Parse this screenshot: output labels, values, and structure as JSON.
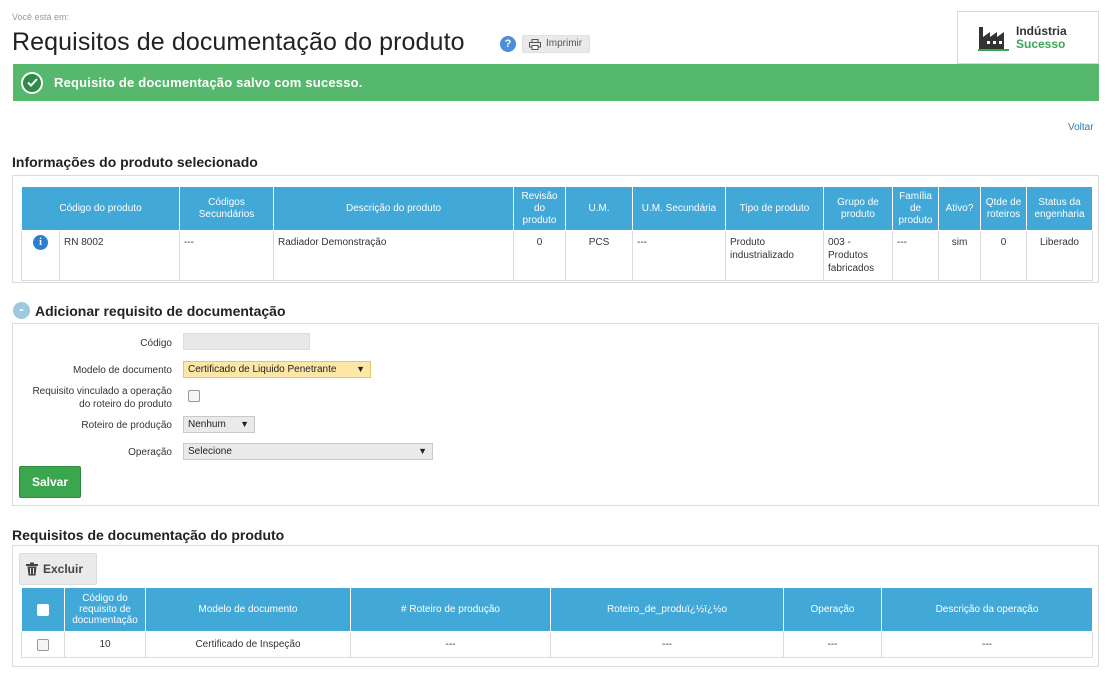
{
  "header": {
    "breadcrumb_label": "Você está em:",
    "title": "Requisitos de documentação do produto",
    "help_icon": "?",
    "print_label": "Imprimir",
    "logo_line1": "Indústria",
    "logo_line2": "Sucesso"
  },
  "alert": {
    "message": "Requisito de documentação salvo com sucesso."
  },
  "back_link": "Voltar",
  "product_info": {
    "section_title": "Informações do produto selecionado",
    "columns": [
      "Código do produto",
      "Códigos Secundários",
      "Descrição do produto",
      "Revisão do produto",
      "U.M.",
      "U.M. Secundária",
      "Tipo de produto",
      "Grupo de produto",
      "Família de produto",
      "Ativo?",
      "Qtde de roteiros",
      "Status da engenharia"
    ],
    "row": {
      "codigo": "RN 8002",
      "codigos_secundarios": "---",
      "descricao": "Radiador Demonstração",
      "revisao": "0",
      "um": "PCS",
      "um_secundaria": "---",
      "tipo": "Produto industrializado",
      "grupo": "003 - Produtos fabricados",
      "familia": "---",
      "ativo": "sim",
      "qtde_roteiros": "0",
      "status": "Liberado"
    }
  },
  "add_form": {
    "section_title": "Adicionar requisito de documentação",
    "collapse_symbol": "-",
    "codigo_label": "Código",
    "codigo_value": "",
    "modelo_label": "Modelo de documento",
    "modelo_value": "Certificado de Liquido Penetrante",
    "vinculado_label_1": "Requisito vinculado a operação",
    "vinculado_label_2": "do roteiro do produto",
    "vinculado_checked": false,
    "roteiro_label": "Roteiro de produção",
    "roteiro_value": "Nenhum",
    "operacao_label": "Operação",
    "operacao_value": "Selecione",
    "save_label": "Salvar"
  },
  "requirements": {
    "section_title": "Requisitos de documentação do produto",
    "delete_label": "Excluir",
    "columns": [
      "Código do requisito de documentação",
      "Modelo de documento",
      "# Roteiro de produção",
      "Roteiro_de_produï¿½ï¿½o",
      "Operação",
      "Descrição da operação"
    ],
    "rows": [
      {
        "codigo": "10",
        "modelo": "Certificado de Inspeção",
        "num_roteiro": "---",
        "roteiro": "---",
        "operacao": "---",
        "descricao_operacao": "---"
      }
    ]
  },
  "icons": {
    "help": "help-icon",
    "print": "printer-icon",
    "logo": "factory-icon",
    "alert": "check-icon",
    "info": "info-icon",
    "delete": "trash-icon",
    "dropdown": "caret-down-icon"
  },
  "colors": {
    "accent_blue": "#42a8d8",
    "success_green": "#56b86d",
    "save_green": "#3aa64e",
    "select_highlight": "#fde7a8",
    "link_blue": "#2a7bb8"
  }
}
